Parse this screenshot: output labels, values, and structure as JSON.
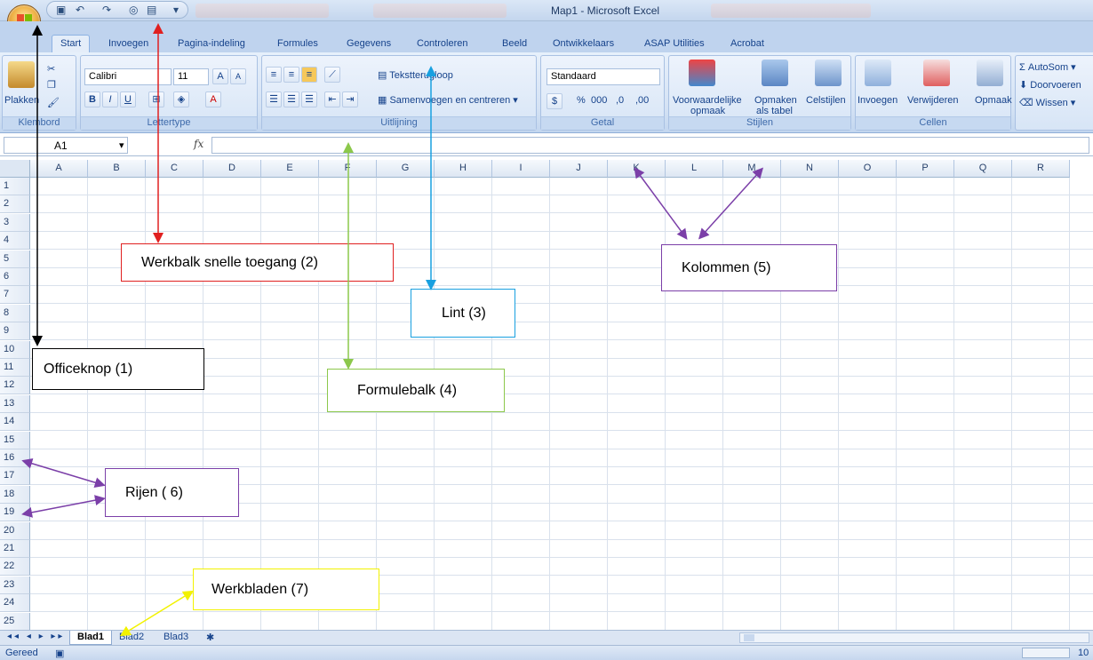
{
  "window": {
    "title": "Map1 - Microsoft Excel"
  },
  "office_button": {
    "icon": "office-logo-icon"
  },
  "quick_access": {
    "icons": [
      "save-icon",
      "undo-icon",
      "redo-icon",
      "circle-icon",
      "form-icon",
      "dropdown-icon"
    ]
  },
  "tabs": [
    "Start",
    "Invoegen",
    "Pagina-indeling",
    "Formules",
    "Gegevens",
    "Controleren",
    "Beeld",
    "Ontwikkelaars",
    "ASAP Utilities",
    "Acrobat"
  ],
  "ribbon": {
    "clipboard": {
      "label": "Klembord",
      "paste": "Plakken"
    },
    "font": {
      "label": "Lettertype",
      "family": "Calibri",
      "size": "11",
      "bold": "B",
      "italic": "I",
      "underline": "U",
      "grow": "A",
      "shrink": "A",
      "fontcolor": "A"
    },
    "alignment": {
      "label": "Uitlijning",
      "wrap": "Tekstterugloop",
      "merge": "Samenvoegen en centreren"
    },
    "number": {
      "label": "Getal",
      "format": "Standaard",
      "percent": "%",
      "thousands": "000",
      "inc": ",0",
      "dec": ",00"
    },
    "styles": {
      "label": "Stijlen",
      "conditional": "Voorwaardelijke",
      "conditional2": "opmaak",
      "table": "Opmaken",
      "table2": "als tabel",
      "cell": "Celstijlen"
    },
    "cells": {
      "label": "Cellen",
      "insert": "Invoegen",
      "delete": "Verwijderen",
      "format": "Opmaak"
    },
    "editing": {
      "autosum": "AutoSom",
      "fill": "Doorvoeren",
      "clear": "Wissen"
    }
  },
  "formula_bar": {
    "name_box": "A1",
    "fx": "fx"
  },
  "columns": [
    "A",
    "B",
    "C",
    "D",
    "E",
    "F",
    "G",
    "H",
    "I",
    "J",
    "K",
    "L",
    "M",
    "N",
    "O",
    "P",
    "Q",
    "R"
  ],
  "rows": [
    "1",
    "2",
    "3",
    "4",
    "5",
    "6",
    "7",
    "8",
    "9",
    "10",
    "11",
    "12",
    "13",
    "14",
    "15",
    "16",
    "17",
    "18",
    "19",
    "20",
    "21",
    "22",
    "23",
    "24",
    "25"
  ],
  "sheets": [
    "Blad1",
    "Blad2",
    "Blad3"
  ],
  "status": {
    "text": "Gereed",
    "zoom": "10"
  },
  "callouts": {
    "officeknop": "Officeknop (1)",
    "werkbalk": "Werkbalk snelle toegang (2)",
    "lint": "Lint (3)",
    "formulebalk": "Formulebalk (4)",
    "kolommen": "Kolommen (5)",
    "rijen": "Rijen ( 6)",
    "werkbladen": "Werkbladen (7)"
  },
  "colors": {
    "red": "#e02020",
    "black": "#000000",
    "blue": "#18a0e0",
    "green": "#8cc84b",
    "purple": "#7b3fa8",
    "yellow": "#f2f200"
  }
}
